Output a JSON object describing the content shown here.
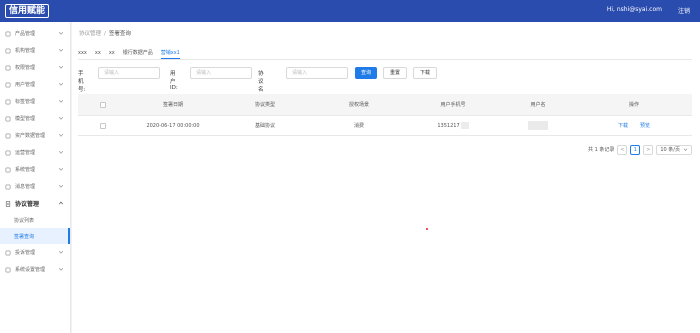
{
  "header": {
    "logo_text": "信用赋能",
    "user_greeting": "Hi, nshi@syai.com",
    "logout_label": "注销"
  },
  "sidebar": {
    "items": [
      {
        "label": "产品管理",
        "icon": "product-icon"
      },
      {
        "label": "机构管理",
        "icon": "org-icon"
      },
      {
        "label": "权限管理",
        "icon": "permission-icon"
      },
      {
        "label": "用户管理",
        "icon": "user-icon"
      },
      {
        "label": "标签管理",
        "icon": "tag-icon"
      },
      {
        "label": "模型管理",
        "icon": "model-icon"
      },
      {
        "label": "资产数据管理",
        "icon": "asset-icon"
      },
      {
        "label": "运营管理",
        "icon": "operation-icon"
      },
      {
        "label": "系统管理",
        "icon": "system-icon"
      },
      {
        "label": "消息管理",
        "icon": "message-icon"
      }
    ],
    "open_group": {
      "label": "协议管理",
      "icon": "protocol-icon",
      "children": [
        {
          "label": "协议列表"
        },
        {
          "label": "签署查询"
        }
      ]
    },
    "items_after": [
      {
        "label": "投诉管理",
        "icon": "complaint-icon"
      },
      {
        "label": "系统设置管理",
        "icon": "settings-icon"
      }
    ]
  },
  "breadcrumb": {
    "parent": "协议管理",
    "separator": "/",
    "current": "签署查询"
  },
  "tabs": [
    {
      "label": "xxx",
      "active": false
    },
    {
      "label": "xx",
      "active": false
    },
    {
      "label": "xx",
      "active": false
    },
    {
      "label": "银行数据产品",
      "active": false
    },
    {
      "label": "营销xx1",
      "active": true
    }
  ],
  "filters": {
    "phone_label": "手机号:",
    "phone_placeholder": "请输入",
    "user_id_label": "用户ID:",
    "user_id_placeholder": "请输入",
    "protocol_name_label": "协议名称:",
    "protocol_name_placeholder": "请输入",
    "query_button": "查询",
    "reset_button": "重置",
    "download_button": "下载"
  },
  "table": {
    "columns": [
      "签署日期",
      "协议类型",
      "授权场景",
      "用户手机号",
      "用户名",
      "操作"
    ],
    "rows": [
      {
        "date": "2020-06-17 00:00:00",
        "type": "基础协议",
        "scenario": "消费",
        "phone": "1351217",
        "username": "",
        "actions": [
          "下载",
          "预览"
        ]
      }
    ]
  },
  "pagination": {
    "total_text": "共 1 条记录",
    "prev": "<",
    "current_page": "1",
    "next": ">",
    "page_size": "10 条/页"
  },
  "colors": {
    "header_bg": "#2a4cae",
    "accent": "#1e7be7"
  }
}
